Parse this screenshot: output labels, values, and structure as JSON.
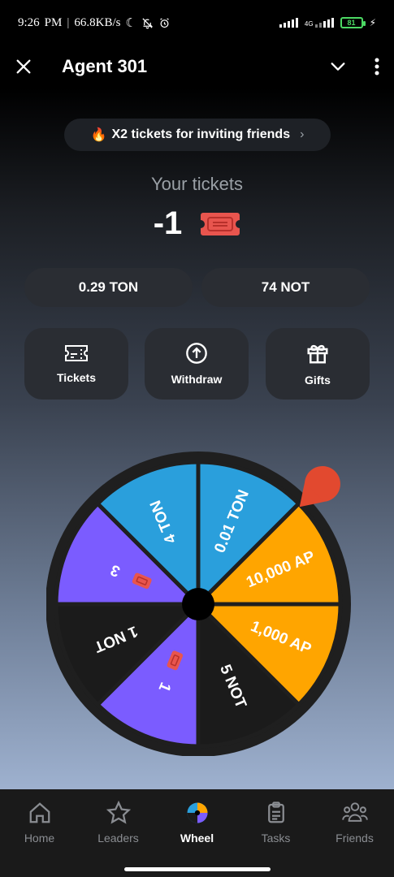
{
  "status_bar": {
    "time": "9:26",
    "ampm": "PM",
    "speed": "66.8KB/s",
    "network": "4G",
    "battery": "81"
  },
  "header": {
    "title": "Agent 301",
    "close_icon": "close-icon",
    "dropdown_icon": "chevron-down-icon",
    "more_icon": "more-vertical-icon"
  },
  "promo": {
    "icon": "fire-icon",
    "text": "X2 tickets for inviting friends",
    "chevron": "›"
  },
  "tickets": {
    "label": "Your tickets",
    "count": "-1",
    "icon": "ticket-icon"
  },
  "balances": [
    {
      "text": "0.29 TON"
    },
    {
      "text": "74 NOT"
    }
  ],
  "actions": [
    {
      "label": "Tickets",
      "icon": "ticket-outline-icon"
    },
    {
      "label": "Withdraw",
      "icon": "arrow-up-circle-icon"
    },
    {
      "label": "Gifts",
      "icon": "gift-icon"
    }
  ],
  "wheel": {
    "segments": [
      {
        "label": "0.01 TON",
        "color": "#2a9fdc"
      },
      {
        "label": "10,000 AP",
        "color": "#ffa500"
      },
      {
        "label": "1,000 AP",
        "color": "#ffa500"
      },
      {
        "label": "5 NOT",
        "color": "#1b1b1b"
      },
      {
        "label": "1",
        "color": "#7b5cff"
      },
      {
        "label": "1 NOT",
        "color": "#1b1b1b"
      },
      {
        "label": "3",
        "color": "#7b5cff"
      },
      {
        "label": "4 TON",
        "color": "#2a9fdc"
      }
    ],
    "pointer_color": "#e2492f"
  },
  "nav": [
    {
      "label": "Home",
      "icon": "home-icon"
    },
    {
      "label": "Leaders",
      "icon": "star-icon"
    },
    {
      "label": "Wheel",
      "icon": "wheel-icon"
    },
    {
      "label": "Tasks",
      "icon": "clipboard-icon"
    },
    {
      "label": "Friends",
      "icon": "friends-icon"
    }
  ]
}
